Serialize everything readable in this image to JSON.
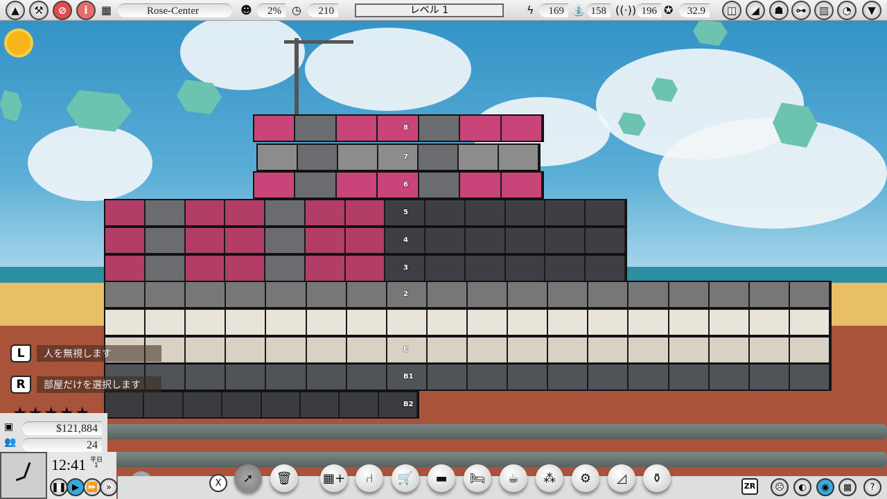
{
  "top_bar": {
    "building_name": "Rose-Center",
    "satisfaction": "2%",
    "time_value": "210",
    "level": "レベル 1",
    "electricity": "169",
    "water": "158",
    "telecom": "196",
    "prestige": "32.9",
    "left_buttons": [
      "collapse-up",
      "build-hammer",
      "cancel",
      "info"
    ],
    "right_buttons": [
      "blueprint",
      "stairs-progress",
      "people",
      "tree",
      "stats",
      "pie-chart",
      "expand-down"
    ]
  },
  "floors": [
    "8",
    "7",
    "6",
    "5",
    "4",
    "3",
    "2",
    "",
    "E",
    "B1",
    "B2"
  ],
  "hints": [
    {
      "key": "L",
      "text": "人を無視します"
    },
    {
      "key": "R",
      "text": "部屋だけを選択します"
    }
  ],
  "status": {
    "rating_stars": 5,
    "money": "$121,884",
    "population": "24",
    "clock_time": "12:41",
    "day_type": "平日",
    "day_number": "1"
  },
  "speed_controls": [
    "pause",
    "play",
    "fast",
    "fastest"
  ],
  "toolbar": {
    "close_label": "X",
    "tools": [
      "select",
      "delete",
      "construct",
      "office",
      "shop",
      "furniture",
      "hotel",
      "cafe",
      "services",
      "maintenance",
      "stairs",
      "decor"
    ]
  },
  "view_controls": {
    "zr_label": "ZR",
    "buttons": [
      "mood",
      "contrast",
      "eye",
      "grid",
      "help"
    ]
  },
  "colors": {
    "room_pink": "#d2487a",
    "topbar": "#e6e6e6",
    "ground": "#a9533a"
  }
}
